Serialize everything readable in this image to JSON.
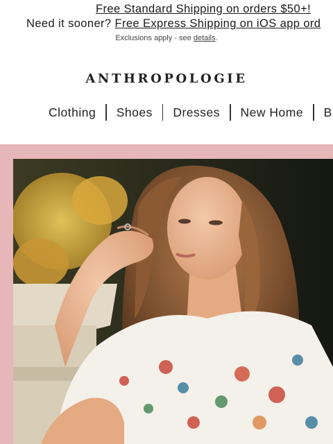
{
  "promo": {
    "line1_link": "Free Standard Shipping on orders $50+!",
    "line2_prefix": "Need it sooner?",
    "line2_link": "Free Express Shipping on iOS app ord",
    "exclusions_prefix": "Exclusions apply - see",
    "exclusions_link": "details",
    "exclusions_suffix": "."
  },
  "brand": {
    "logo": "ANTHROPOLOGIE"
  },
  "nav": {
    "items": [
      "Clothing",
      "Shoes",
      "Dresses",
      "New Home",
      "B"
    ]
  },
  "colors": {
    "hero_band": "#e6b6b9",
    "text": "#1a1a1a"
  },
  "hero": {
    "description_icon": "hero-photo-woman-floral-blouse"
  }
}
